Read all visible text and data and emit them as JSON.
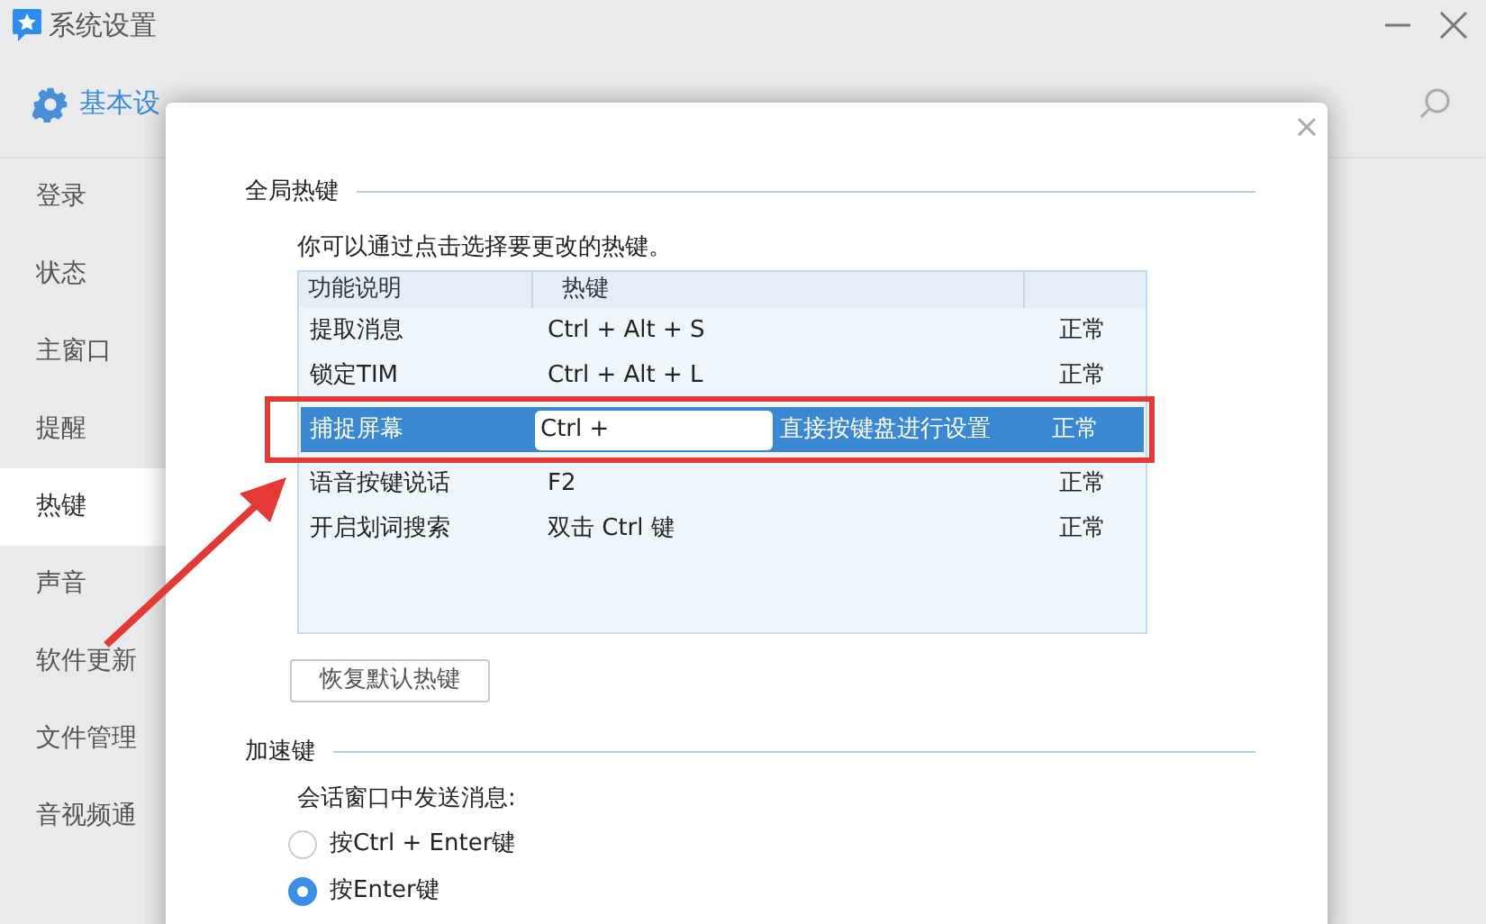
{
  "window": {
    "title": "系统设置"
  },
  "tabs": [
    {
      "label": "基本设",
      "selected": true
    }
  ],
  "sidebar": {
    "items": [
      {
        "label": "登录",
        "selected": false
      },
      {
        "label": "状态",
        "selected": false
      },
      {
        "label": "主窗口",
        "selected": false
      },
      {
        "label": "提醒",
        "selected": false
      },
      {
        "label": "热键",
        "selected": true
      },
      {
        "label": "声音",
        "selected": false
      },
      {
        "label": "软件更新",
        "selected": false
      },
      {
        "label": "文件管理",
        "selected": false
      },
      {
        "label": "音视频通",
        "selected": false
      }
    ]
  },
  "dialog": {
    "global_hotkeys": {
      "title": "全局热键",
      "hint": "你可以通过点击选择要更改的热键。",
      "table": {
        "columns": [
          "功能说明",
          "热键"
        ],
        "rows": [
          {
            "kind": "plain",
            "function": "提取消息",
            "hotkey": "Ctrl + Alt + S",
            "status": "正常",
            "selected": false
          },
          {
            "kind": "plain",
            "function": "锁定TIM",
            "hotkey": "Ctrl + Alt + L",
            "status": "正常",
            "selected": false
          },
          {
            "kind": "editing",
            "function": "捕捉屏幕",
            "hotkey": "Ctrl +",
            "prompt": "直接按键盘进行设置",
            "status": "正常",
            "selected": true
          },
          {
            "kind": "plain",
            "function": "语音按键说话",
            "hotkey": "F2",
            "status": "正常",
            "selected": false
          },
          {
            "kind": "plain",
            "function": "开启划词搜索",
            "hotkey": "双击 Ctrl 键",
            "status": "正常",
            "selected": false
          }
        ]
      },
      "reset_button": "恢复默认热键"
    },
    "accelerator": {
      "title": "加速键",
      "label": "会话窗口中发送消息:",
      "options": [
        {
          "label": "按Ctrl + Enter键",
          "selected": false
        },
        {
          "label": "按Enter键",
          "selected": true
        }
      ]
    }
  }
}
